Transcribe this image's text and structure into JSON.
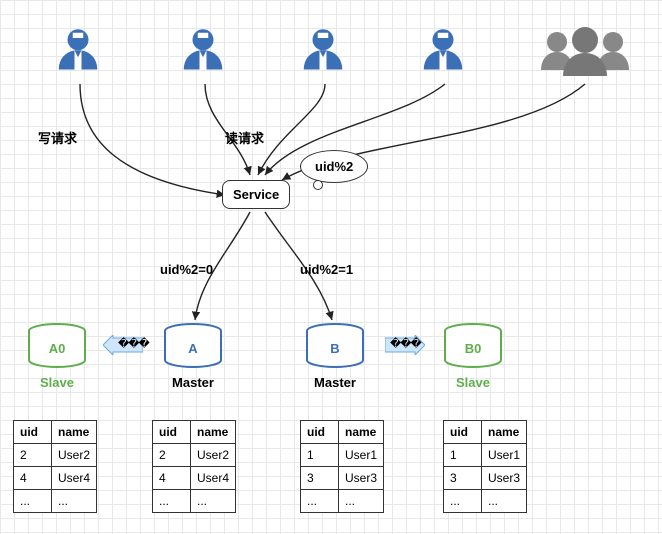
{
  "labels": {
    "write_request": "写请求",
    "read_request": "读请求",
    "service": "Service",
    "shard_rule": "uid%2",
    "route_left": "uid%2=0",
    "route_right": "uid%2=1"
  },
  "dbs": {
    "a0": {
      "name": "A0",
      "role": "Slave"
    },
    "a": {
      "name": "A",
      "role": "Master"
    },
    "b": {
      "name": "B",
      "role": "Master"
    },
    "b0": {
      "name": "B0",
      "role": "Slave"
    }
  },
  "table_headers": {
    "uid": "uid",
    "name": "name"
  },
  "tables": {
    "a0": [
      {
        "uid": "2",
        "name": "User2"
      },
      {
        "uid": "4",
        "name": "User4"
      },
      {
        "uid": "...",
        "name": "..."
      }
    ],
    "a": [
      {
        "uid": "2",
        "name": "User2"
      },
      {
        "uid": "4",
        "name": "User4"
      },
      {
        "uid": "...",
        "name": "..."
      }
    ],
    "b": [
      {
        "uid": "1",
        "name": "User1"
      },
      {
        "uid": "3",
        "name": "User3"
      },
      {
        "uid": "...",
        "name": "..."
      }
    ],
    "b0": [
      {
        "uid": "1",
        "name": "User1"
      },
      {
        "uid": "3",
        "name": "User3"
      },
      {
        "uid": "...",
        "name": "..."
      }
    ]
  },
  "replication_text": "���"
}
